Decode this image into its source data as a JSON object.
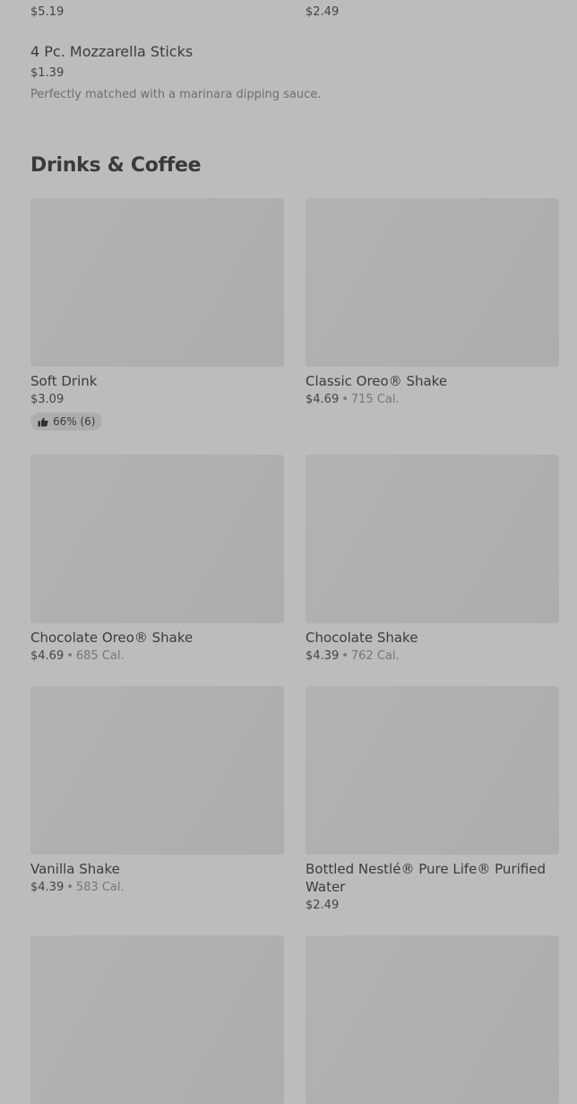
{
  "previous_items": {
    "left_price": "$5.19",
    "right_price": "$2.49"
  },
  "list_item": {
    "name": "4 Pc. Mozzarella Sticks",
    "price": "$1.39",
    "description": "Perfectly matched with a marinara dipping sauce."
  },
  "section": {
    "title": "Drinks & Coffee"
  },
  "items": [
    {
      "name": "Soft Drink",
      "price": "$3.09",
      "calories": "",
      "rating": "66% (6)"
    },
    {
      "name": "Classic Oreo® Shake",
      "price": "$4.69",
      "calories": "715 Cal."
    },
    {
      "name": "Chocolate Oreo® Shake",
      "price": "$4.69",
      "calories": "685 Cal."
    },
    {
      "name": "Chocolate Shake",
      "price": "$4.39",
      "calories": "762 Cal."
    },
    {
      "name": "Vanilla Shake",
      "price": "$4.39",
      "calories": "583 Cal."
    },
    {
      "name": "Bottled Nestlé® Pure Life® Purified Water",
      "price": "$2.49",
      "calories": ""
    },
    {
      "name": "",
      "price": "",
      "calories": ""
    },
    {
      "name": "",
      "price": "",
      "calories": ""
    }
  ],
  "separator": "•",
  "icons": {
    "rating": "thumbs-up-icon"
  }
}
